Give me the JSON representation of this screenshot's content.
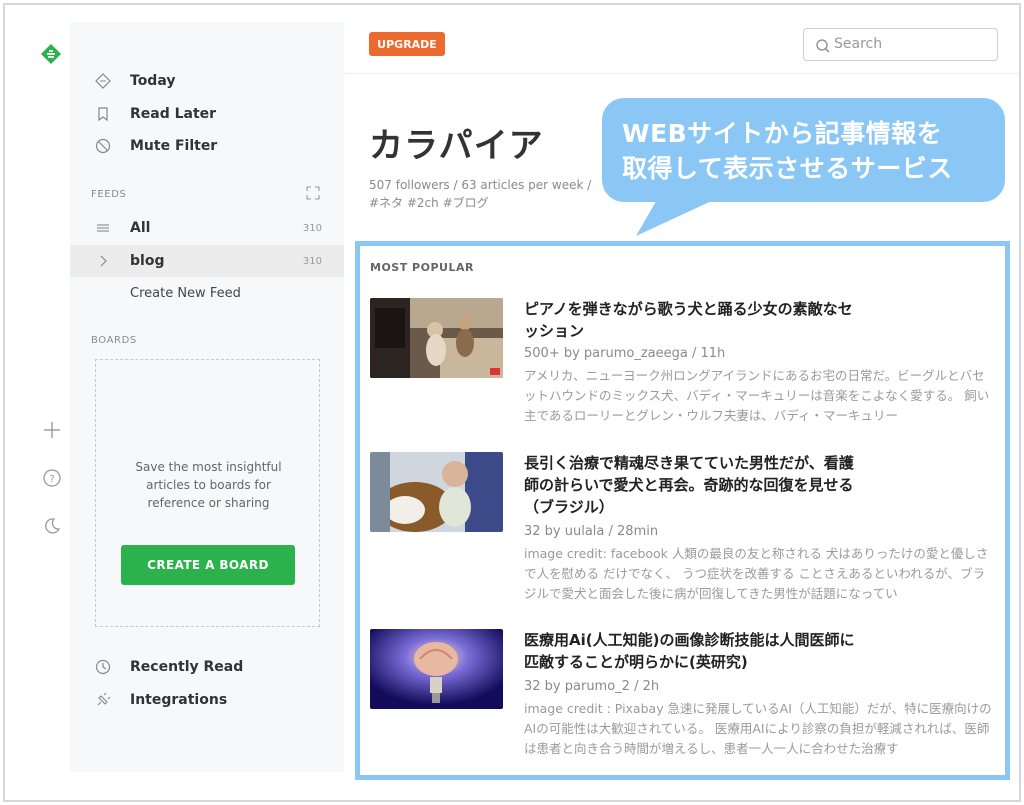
{
  "sidebar": {
    "nav": [
      {
        "label": "Today",
        "icon": "today-icon"
      },
      {
        "label": "Read Later",
        "icon": "bookmark-icon"
      },
      {
        "label": "Mute Filter",
        "icon": "mute-icon"
      }
    ],
    "feeds_label": "FEEDS",
    "feeds": [
      {
        "label": "All",
        "count": "310"
      },
      {
        "label": "blog",
        "count": "310"
      }
    ],
    "create_feed_label": "Create New Feed",
    "boards_label": "BOARDS",
    "boards_text": "Save the most insightful articles to boards for reference or sharing",
    "create_board_label": "CREATE A BOARD",
    "bottom": [
      {
        "label": "Recently Read",
        "icon": "clock-icon"
      },
      {
        "label": "Integrations",
        "icon": "plug-icon"
      }
    ]
  },
  "topbar": {
    "upgrade_label": "UPGRADE",
    "search_placeholder": "Search"
  },
  "feed": {
    "title": "カラパイア",
    "meta": "507 followers / 63 articles per week / #ネタ  #2ch  #ブログ"
  },
  "callout": {
    "line1": "WEBサイトから記事情報を",
    "line2": "取得して表示させるサービス"
  },
  "popular": {
    "label": "MOST POPULAR",
    "articles": [
      {
        "title": "ピアノを弾きながら歌う犬と踊る少女の素敵なセッション",
        "meta": "500+  by parumo_zaeega / 11h",
        "summary": "アメリカ、ニューヨーク州ロングアイランドにあるお宅の日常だ。ビーグルとバセットハウンドのミックス犬、バディ・マーキュリーは音楽をこよなく愛する。 飼い主であるローリーとグレン・ウルフ夫妻は、バディ・マーキュリー"
      },
      {
        "title": "長引く治療で精魂尽き果てていた男性だが、看護師の計らいで愛犬と再会。奇跡的な回復を見せる（ブラジル）",
        "meta": "32  by uulala / 28min",
        "summary": "image credit: facebook 人類の最良の友と称される 犬はありったけの愛と優しさで人を慰める だけでなく、 うつ症状を改善する ことさえあるといわれるが、ブラジルで愛犬と面会した後に病が回復してきた男性が話題になってい"
      },
      {
        "title": "医療用Ai(人工知能)の画像診断技能は人間医師に匹敵することが明らかに(英研究)",
        "meta": "32  by parumo_2 / 2h",
        "summary": "image credit : Pixabay 急速に発展しているAI（人工知能）だが、特に医療向けのAIの可能性は大歓迎されている。 医療用AIにより診察の負担が軽減されれば、医師は患者と向き合う時間が増えるし、患者一人一人に合わせた治療す"
      }
    ]
  },
  "colors": {
    "accent_green": "#2bb24c",
    "upgrade_orange": "#ec6a2e",
    "callout_blue": "#8bc7f5"
  }
}
